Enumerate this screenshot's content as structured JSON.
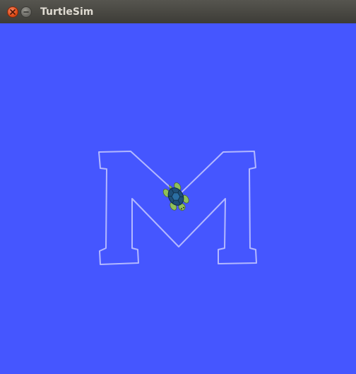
{
  "window": {
    "title": "TurtleSim"
  },
  "canvas": {
    "background_color": "#4556ff",
    "pen_color": "#b3b8ff"
  },
  "turtle": {
    "icon": "turtle-icon",
    "shell_color": "#1f4f78",
    "body_color": "#8fc05a"
  },
  "buttons": {
    "close_icon": "close-icon",
    "minimize_icon": "minimize-icon"
  }
}
